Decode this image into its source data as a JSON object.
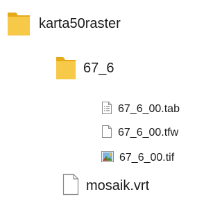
{
  "tree": {
    "root_folder": {
      "label": "karta50raster",
      "icon": "folder-icon"
    },
    "sub_folder": {
      "label": "67_6",
      "icon": "folder-icon"
    },
    "files": [
      {
        "label": "67_6_00.tab",
        "icon": "text-file-icon"
      },
      {
        "label": "67_6_00.tfw",
        "icon": "blank-file-icon"
      },
      {
        "label": "67_6_00.tif",
        "icon": "image-file-icon"
      }
    ],
    "root_file": {
      "label": "mosaik.vrt",
      "icon": "blank-file-icon"
    }
  },
  "colors": {
    "folder_body": "#f7c948",
    "folder_tab": "#e6a91a",
    "file_outline": "#8a8a8a",
    "text": "#1a1a1a"
  }
}
